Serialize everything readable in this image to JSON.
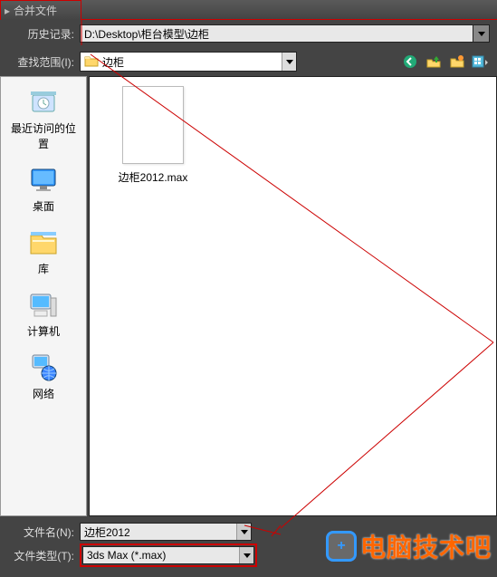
{
  "window": {
    "title": "合并文件"
  },
  "history": {
    "label": "历史记录:",
    "value": "D:\\Desktop\\柜台模型\\边柜"
  },
  "lookin": {
    "label": "查找范围(I):",
    "value": "边柜"
  },
  "toolbar_icons": [
    "back-icon",
    "up-icon",
    "new-folder-icon",
    "view-menu-icon"
  ],
  "sidebar": {
    "items": [
      {
        "label": "最近访问的位置",
        "icon": "recent-icon"
      },
      {
        "label": "桌面",
        "icon": "desktop-icon"
      },
      {
        "label": "库",
        "icon": "libraries-icon"
      },
      {
        "label": "计算机",
        "icon": "computer-icon"
      },
      {
        "label": "网络",
        "icon": "network-icon"
      }
    ]
  },
  "files": [
    {
      "name": "边柜2012.max"
    }
  ],
  "filename": {
    "label": "文件名(N):",
    "value": "边柜2012"
  },
  "filetype": {
    "label": "文件类型(T):",
    "value": "3ds Max (*.max)"
  },
  "watermark": {
    "text": "电脑技术吧"
  }
}
